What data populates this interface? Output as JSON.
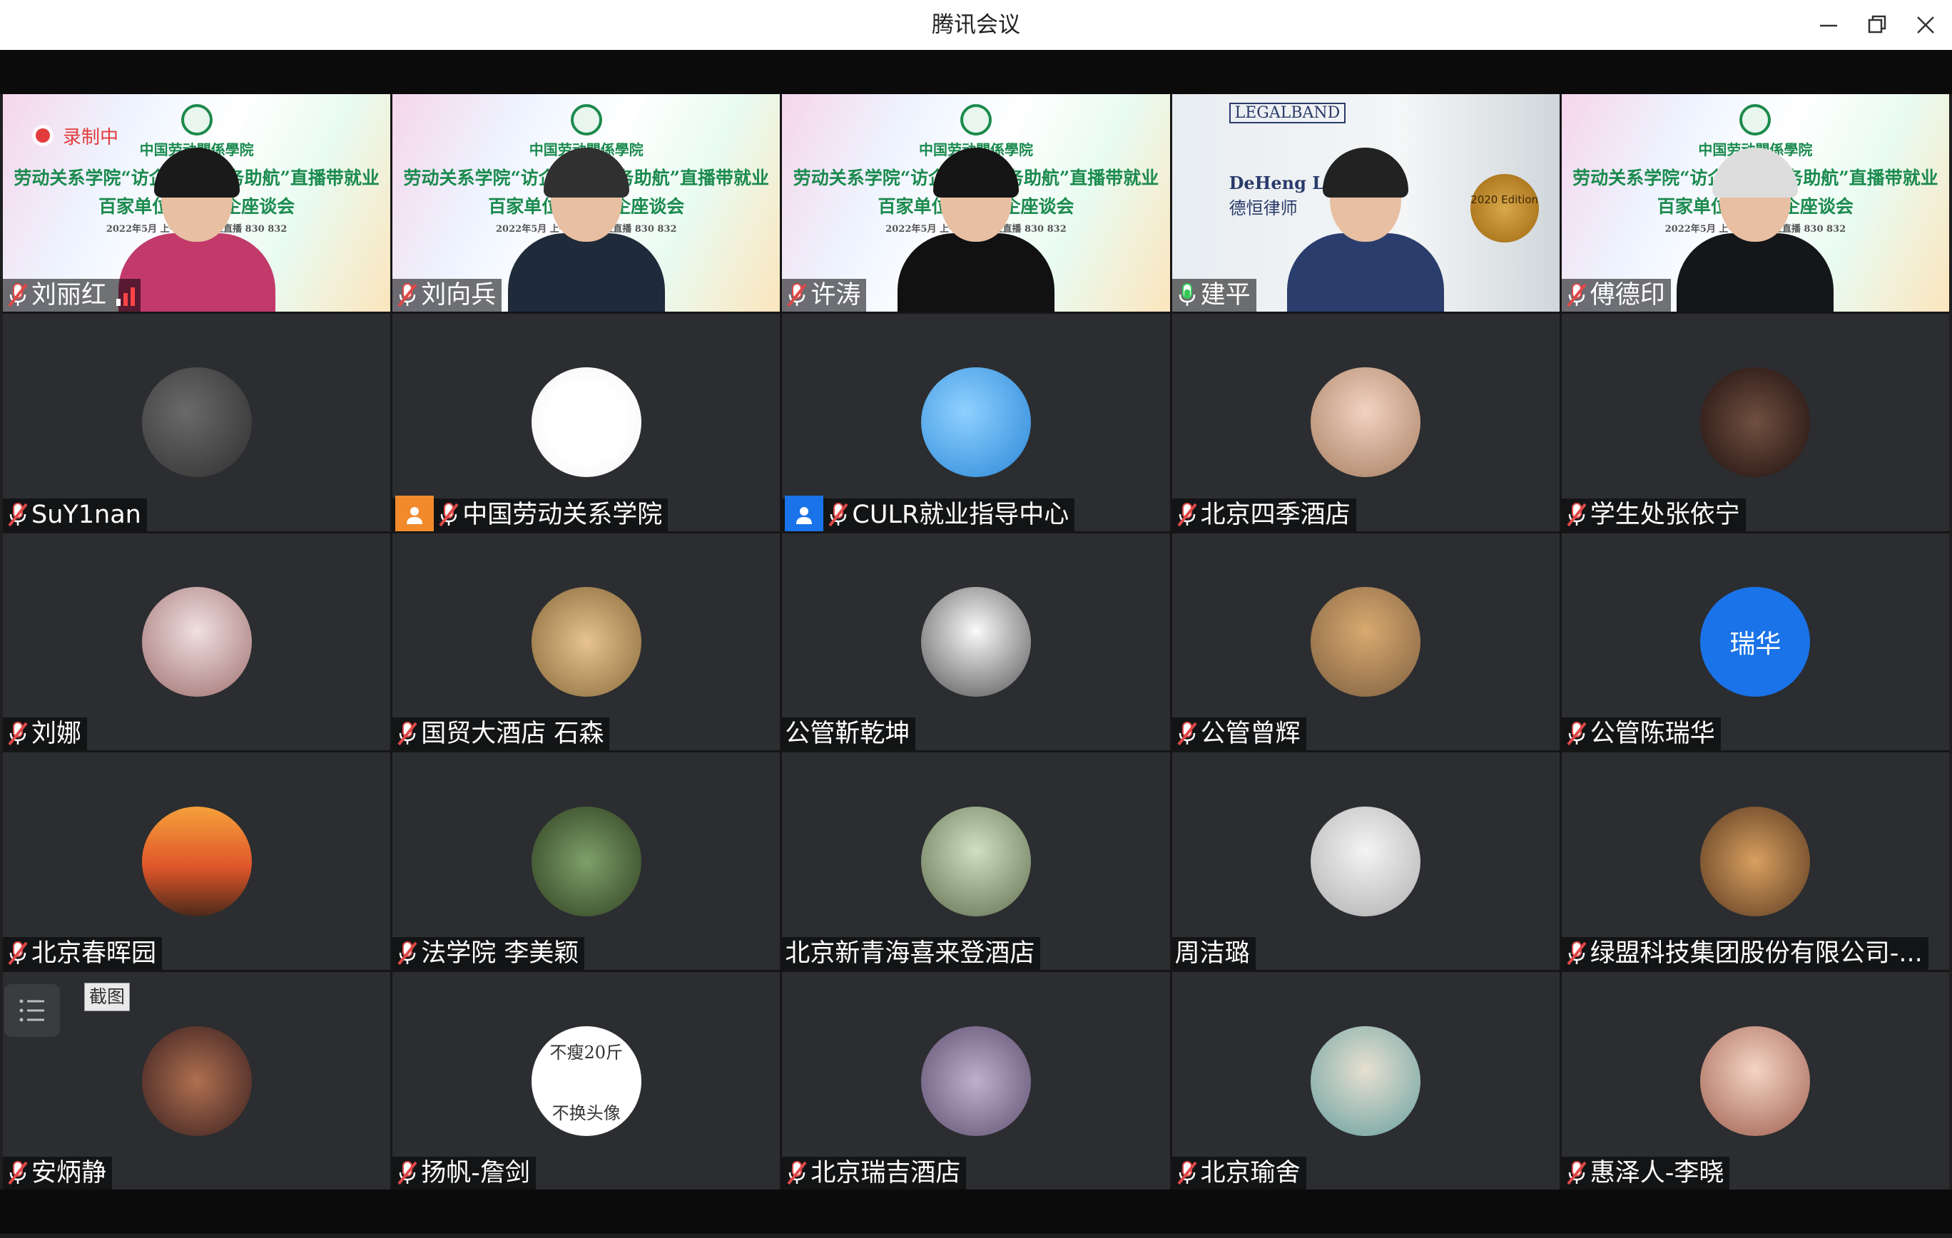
{
  "window": {
    "title": "腾讯会议"
  },
  "recording": {
    "label": "录制中"
  },
  "tooltip": {
    "label": "截图"
  },
  "colors": {
    "record": "#e23b3b",
    "muted_mic": "#e04848",
    "active_mic": "#36c95a",
    "accent": "#1a73e8"
  },
  "slide_text": {
    "school": "中国劳动關係學院",
    "headline": "劳动关系学院“访企拓岗 服务助航”直播带就业",
    "subline": "百家单位线上访企座谈会",
    "details": "2022年5月 上午9:30 线上直播 830 832"
  },
  "cert_text": {
    "brand": "LEGALBAND",
    "firm_en": "DeHeng Law",
    "firm_cn": "德恒律师",
    "edition": "2020 Edition"
  },
  "tiles": [
    {
      "name": "刘丽红",
      "mic": "muted",
      "kind": "slide",
      "signal": true
    },
    {
      "name": "刘向兵",
      "mic": "muted",
      "kind": "slide"
    },
    {
      "name": "许涛",
      "mic": "muted",
      "kind": "slide"
    },
    {
      "name": "建平",
      "mic": "active",
      "kind": "cert"
    },
    {
      "name": "傅德印",
      "mic": "muted",
      "kind": "slide"
    },
    {
      "name": "SuY1nan",
      "mic": "muted",
      "kind": "avatar"
    },
    {
      "name": "中国劳动关系学院",
      "mic": "muted",
      "kind": "avatar",
      "tag": "orange"
    },
    {
      "name": "CULR就业指导中心",
      "mic": "muted",
      "kind": "avatar",
      "tag": "blue"
    },
    {
      "name": "北京四季酒店",
      "mic": "muted",
      "kind": "avatar"
    },
    {
      "name": "学生处张依宁",
      "mic": "muted",
      "kind": "avatar"
    },
    {
      "name": "刘娜",
      "mic": "muted",
      "kind": "avatar"
    },
    {
      "name": "国贸大酒店 石森",
      "mic": "muted",
      "kind": "avatar"
    },
    {
      "name": "公管靳乾坤",
      "mic": "none",
      "kind": "avatar"
    },
    {
      "name": "公管曾辉",
      "mic": "muted",
      "kind": "avatar"
    },
    {
      "name": "公管陈瑞华",
      "mic": "muted",
      "kind": "avatar",
      "avatar_text": "瑞华"
    },
    {
      "name": "北京春晖园",
      "mic": "muted",
      "kind": "avatar"
    },
    {
      "name": "法学院 李美颖",
      "mic": "muted",
      "kind": "avatar"
    },
    {
      "name": "北京新青海喜来登酒店",
      "mic": "none",
      "kind": "avatar"
    },
    {
      "name": "周洁璐",
      "mic": "none",
      "kind": "avatar"
    },
    {
      "name": "绿盟科技集团股份有限公司-...",
      "mic": "muted",
      "kind": "avatar"
    },
    {
      "name": "安炳静",
      "mic": "muted",
      "kind": "avatar"
    },
    {
      "name": "扬帆-詹剑",
      "mic": "muted",
      "kind": "avatar",
      "avatar_lines": [
        "不瘦20斤",
        "不换头像"
      ]
    },
    {
      "name": "北京瑞吉酒店",
      "mic": "muted",
      "kind": "avatar"
    },
    {
      "name": "北京瑜舍",
      "mic": "muted",
      "kind": "avatar"
    },
    {
      "name": "惠泽人-李晓",
      "mic": "muted",
      "kind": "avatar"
    }
  ]
}
